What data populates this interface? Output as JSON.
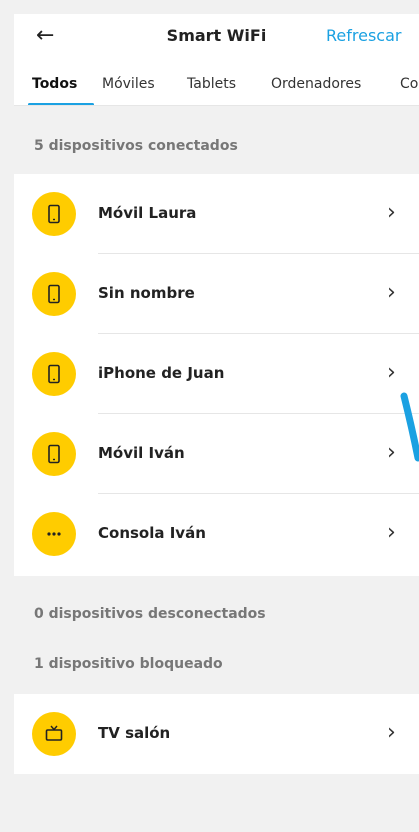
{
  "header": {
    "back_icon": "arrow-left-icon",
    "title": "Smart WiFi",
    "refresh_label": "Refrescar"
  },
  "tabs": [
    {
      "label": "Todos",
      "active": true
    },
    {
      "label": "Móviles",
      "active": false
    },
    {
      "label": "Tablets",
      "active": false
    },
    {
      "label": "Ordenadores",
      "active": false
    },
    {
      "label": "Co",
      "active": false
    }
  ],
  "connected": {
    "heading": "5 dispositivos conectados",
    "devices": [
      {
        "name": "Móvil Laura",
        "icon": "phone-icon"
      },
      {
        "name": "Sin nombre",
        "icon": "phone-icon"
      },
      {
        "name": "iPhone de Juan",
        "icon": "phone-icon"
      },
      {
        "name": "Móvil Iván",
        "icon": "phone-icon"
      },
      {
        "name": "Consola Iván",
        "icon": "more-icon"
      }
    ]
  },
  "disconnected": {
    "heading": "0 dispositivos desconectados"
  },
  "blocked": {
    "heading": "1 dispositivo bloqueado",
    "devices": [
      {
        "name": "TV salón",
        "icon": "tv-icon"
      }
    ]
  },
  "colors": {
    "accent": "#1ba1e2",
    "device_icon_bg": "#ffcc00"
  }
}
